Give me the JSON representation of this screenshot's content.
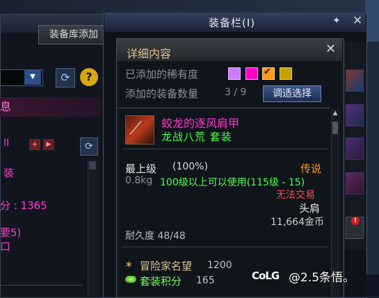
{
  "left": {
    "lib_add_button": "装备库添加",
    "info_tab": "息",
    "roman": "II",
    "sq1": "+",
    "sq2": "▶",
    "text1": "装",
    "text2_prefix": "分 : ",
    "text2_value": "1365",
    "text3": "要5)",
    "text4": "⼝"
  },
  "main": {
    "title": "装备栏(I)"
  },
  "detail": {
    "title": "详细内容",
    "rarity_label": "已添加的稀有度",
    "count_label": "添加的装备数量",
    "count_value": "3 / 9",
    "adjust_button": "调适选择",
    "item_name": "蛟龙的逐风肩甲",
    "item_set": "龙战八荒  套装",
    "grade": "最上级",
    "grade_pct": "(100%)",
    "rarity_name": "传说",
    "weight": "0.8kg",
    "level_req": "100级以上可以使用(115级 - 15)",
    "untradable": "无法交易",
    "slot_type": "头肩",
    "price": "11,664金币",
    "durability": "耐久度 48/48",
    "adventurer_label": "冒险家名望",
    "adventurer_value": "1200",
    "set_score_label": "套装积分",
    "set_score_value": "165"
  },
  "rarity_colors": [
    "#c97cff",
    "#ff00c8",
    "#ff9a1a",
    "#c3a000"
  ],
  "watermark": {
    "logo": "CoLG",
    "text": "@2.5条悟。"
  },
  "icons": {
    "close": "✕",
    "pin": "📌",
    "refresh": "⟳",
    "help": "?",
    "chevron_down": "▼",
    "check": "✔",
    "scroll_up": "▲",
    "item_slot_badge": "!"
  }
}
